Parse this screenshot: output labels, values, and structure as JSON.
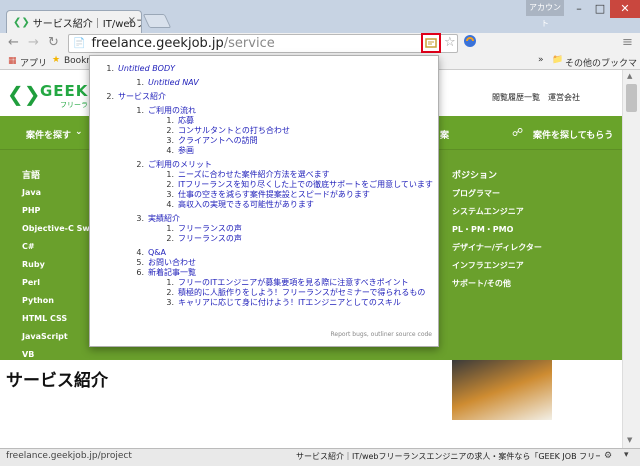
{
  "browser": {
    "tab_title": "サービス紹介｜IT/webフリ",
    "tab_close": "×",
    "account_label": "アカウント",
    "url_host": "freelance.geekjob.jp",
    "url_path": "/service",
    "bookmarks": {
      "apps_label": "アプリ",
      "bookmark_label": "Bookm",
      "overflow": "»",
      "other_label": "その他のブックマーク"
    },
    "status_url": "freelance.geekjob.jp/project",
    "status_tab_title": "サービス紹介｜IT/webフリーランスエンジニアの求人・案件なら「GEEK JOB フリーランス」"
  },
  "site": {
    "logo_text": "GEEK",
    "logo_sub": "フリーラ",
    "header_links": [
      "閲覧履歴一覧",
      "運営会社"
    ],
    "menu": {
      "left": "案件を探す",
      "mid_fragment": "案",
      "right": "案件を探してもらう"
    },
    "lang_heading": "言語",
    "languages": [
      "Java",
      "PHP",
      "Objective-C Swift",
      "C#",
      "Ruby",
      "Perl",
      "Python",
      "HTML CSS",
      "JavaScript",
      "VB"
    ],
    "position_heading": "ポジション",
    "positions": [
      "プログラマー",
      "システムエンジニア",
      "PL・PM・PMO",
      "デザイナー/ディレクター",
      "インフラエンジニア",
      "サポート/その他"
    ],
    "page_title": "サービス紹介"
  },
  "outline": {
    "rows": [
      {
        "num": "1.",
        "text": "Untitled BODY",
        "level": 0,
        "italic": true
      },
      {
        "num": "1.",
        "text": "Untitled NAV",
        "level": 1,
        "italic": true
      },
      {
        "num": "2.",
        "text": "サービス紹介",
        "level": 0,
        "italic": false
      },
      {
        "num": "1.",
        "text": "ご利用の流れ",
        "level": 1,
        "italic": false
      },
      {
        "num": "1.",
        "text": "応募",
        "level": 2,
        "italic": false
      },
      {
        "num": "2.",
        "text": "コンサルタントとの打ち合わせ",
        "level": 2,
        "italic": false
      },
      {
        "num": "3.",
        "text": "クライアントへの訪問",
        "level": 2,
        "italic": false
      },
      {
        "num": "4.",
        "text": "参画",
        "level": 2,
        "italic": false
      },
      {
        "num": "2.",
        "text": "ご利用のメリット",
        "level": 1,
        "italic": false
      },
      {
        "num": "1.",
        "text": "ニーズに合わせた案件紹介方法を選べます",
        "level": 2,
        "italic": false
      },
      {
        "num": "2.",
        "text": "ITフリーランスを知り尽くした上での徹底サポートをご用意しています",
        "level": 2,
        "italic": false
      },
      {
        "num": "3.",
        "text": "仕事の空きを減らす案件提案設とスピードがあります",
        "level": 2,
        "italic": false
      },
      {
        "num": "4.",
        "text": "高収入の実現できる可能性があります",
        "level": 2,
        "italic": false
      },
      {
        "num": "3.",
        "text": "実績紹介",
        "level": 1,
        "italic": false
      },
      {
        "num": "1.",
        "text": "フリーランスの声",
        "level": 2,
        "italic": false
      },
      {
        "num": "2.",
        "text": "フリーランスの声",
        "level": 2,
        "italic": false
      },
      {
        "num": "4.",
        "text": "Q&A",
        "level": 1,
        "italic": false
      },
      {
        "num": "5.",
        "text": "お問い合わせ",
        "level": 1,
        "italic": false
      },
      {
        "num": "6.",
        "text": "新着記事一覧",
        "level": 1,
        "italic": false
      },
      {
        "num": "1.",
        "text": "フリーのITエンジニアが募集要項を見る際に注意すべきポイント",
        "level": 2,
        "italic": false
      },
      {
        "num": "2.",
        "text": "積極的に人脈作りをしよう！フリーランスがセミナーで得られるもの",
        "level": 2,
        "italic": false
      },
      {
        "num": "3.",
        "text": "キャリアに応じて身に付けよう！ITエンジニアとしてのスキル",
        "level": 2,
        "italic": false
      }
    ],
    "footer": "Report bugs, outliner source code"
  },
  "colors": {
    "brand_green": "#6aa02c",
    "outline_link": "#2222bb",
    "highlight": "#e0001a"
  }
}
